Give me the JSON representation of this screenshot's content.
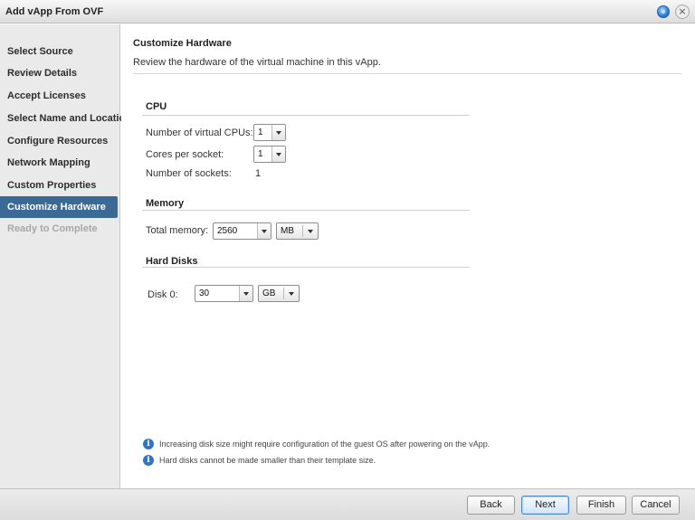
{
  "window": {
    "title": "Add vApp From OVF",
    "help_icon": "help-icon",
    "close_icon": "close-icon"
  },
  "sidebar": {
    "items": [
      {
        "label": "Select Source",
        "state": "done"
      },
      {
        "label": "Review Details",
        "state": "done"
      },
      {
        "label": "Accept Licenses",
        "state": "done"
      },
      {
        "label": "Select Name and Location",
        "state": "done"
      },
      {
        "label": "Configure Resources",
        "state": "done"
      },
      {
        "label": "Network Mapping",
        "state": "done"
      },
      {
        "label": "Custom Properties",
        "state": "done"
      },
      {
        "label": "Customize Hardware",
        "state": "active"
      },
      {
        "label": "Ready to Complete",
        "state": "disabled"
      }
    ],
    "active_color": "#3c6a97"
  },
  "page": {
    "title": "Customize Hardware",
    "subtitle": "Review the hardware of the virtual machine in this vApp."
  },
  "cpu": {
    "title": "CPU",
    "num_cpus_label": "Number of virtual CPUs:",
    "num_cpus_value": "1",
    "cores_label": "Cores per socket:",
    "cores_value": "1",
    "sockets_label": "Number of sockets:",
    "sockets_value": "1"
  },
  "memory": {
    "title": "Memory",
    "total_label": "Total memory:",
    "total_value": "2560",
    "unit": "MB"
  },
  "disks": {
    "title": "Hard Disks",
    "disk0_label": "Disk 0:",
    "disk0_value": "30",
    "disk0_unit": "GB"
  },
  "notes": [
    "Increasing disk size might require configuration of the guest OS after powering on the vApp.",
    "Hard disks cannot be made smaller than their template size."
  ],
  "footer": {
    "back": "Back",
    "next": "Next",
    "finish": "Finish",
    "cancel": "Cancel"
  }
}
